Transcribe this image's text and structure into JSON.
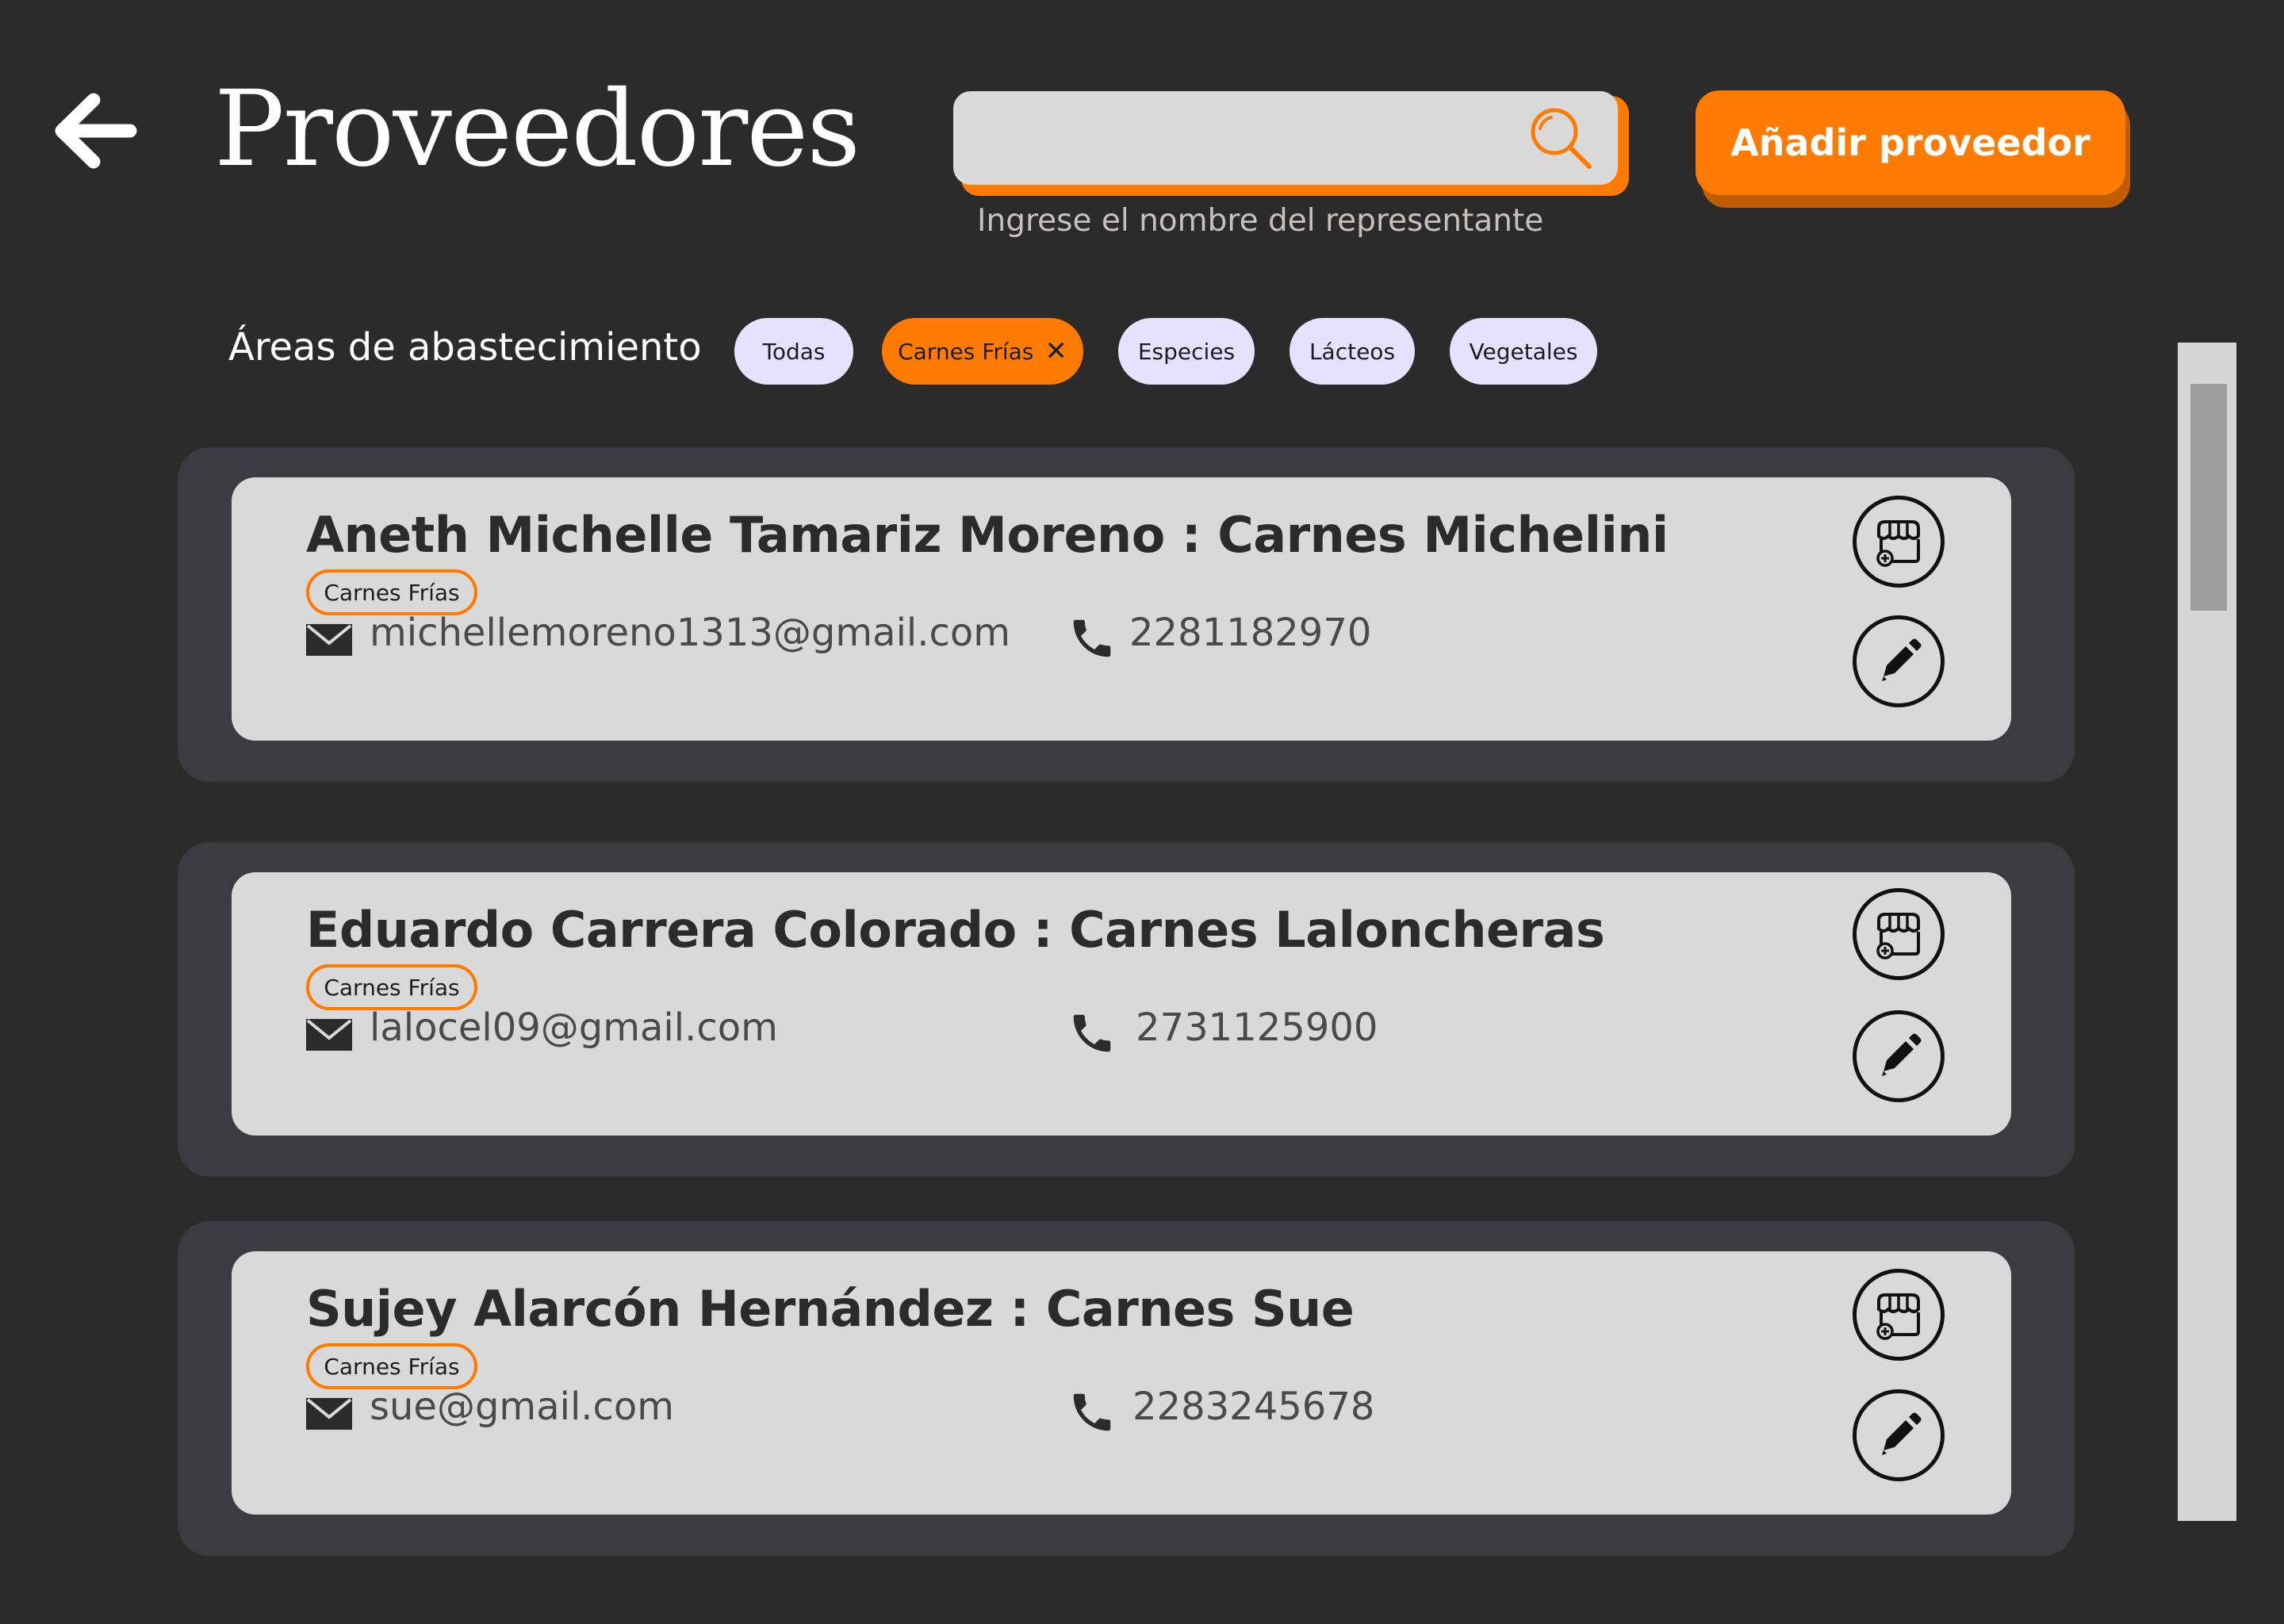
{
  "header": {
    "title": "Proveedores",
    "back_icon": "arrow-left-icon"
  },
  "search": {
    "value": "",
    "placeholder": "",
    "hint": "Ingrese el nombre del representante",
    "icon": "search-icon"
  },
  "add_button": {
    "label": "Añadir proveedor"
  },
  "filters": {
    "label": "Áreas de abastecimiento",
    "chips": [
      {
        "label": "Todas",
        "active": false
      },
      {
        "label": "Carnes Frías",
        "active": true,
        "remove_symbol": "✕"
      },
      {
        "label": "Especies",
        "active": false
      },
      {
        "label": "Lácteos",
        "active": false
      },
      {
        "label": "Vegetales",
        "active": false
      }
    ]
  },
  "suppliers": [
    {
      "title": "Aneth Michelle Tamariz Moreno : Carnes Michelini",
      "tag": "Carnes Frías",
      "email": "michellemoreno1313@gmail.com",
      "phone": "2281182970"
    },
    {
      "title": "Eduardo Carrera Colorado : Carnes Laloncheras",
      "tag": "Carnes Frías",
      "email": "lalocel09@gmail.com",
      "phone": "2731125900"
    },
    {
      "title": "Sujey Alarcón Hernández : Carnes Sue",
      "tag": "Carnes Frías",
      "email": "sue@gmail.com",
      "phone": "2283245678"
    }
  ],
  "icons": {
    "email": "envelope-icon",
    "phone": "phone-icon",
    "store": "store-add-icon",
    "edit": "pencil-icon"
  },
  "colors": {
    "background": "#2b2b2b",
    "accent": "#ff7a00",
    "chip": "#e8e0ff",
    "card_outer": "#3a3c42",
    "card_inner": "#d9d9d9"
  }
}
